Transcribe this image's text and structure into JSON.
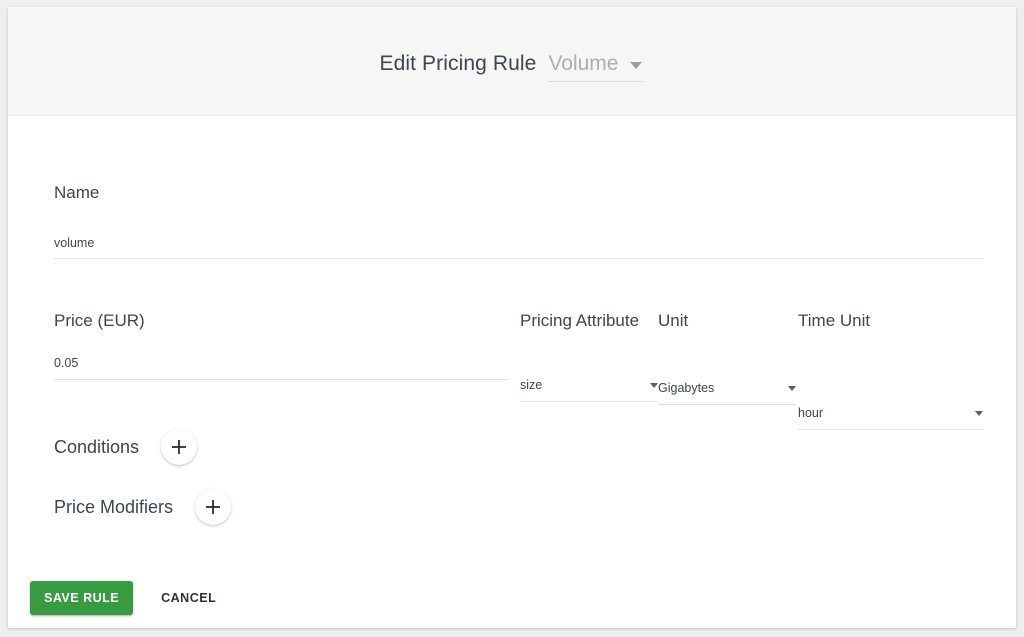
{
  "header": {
    "title": "Edit Pricing Rule",
    "rule_select": {
      "value": "Volume",
      "icon": "caret-down-icon"
    }
  },
  "form": {
    "name": {
      "label": "Name",
      "value": "volume"
    },
    "price": {
      "label": "Price (EUR)",
      "value": "0.05"
    },
    "pricing_attribute": {
      "label": "Pricing Attribute",
      "value": "size",
      "icon": "caret-down-icon"
    },
    "unit": {
      "label": "Unit",
      "value": "Gigabytes",
      "icon": "caret-down-icon"
    },
    "time_unit": {
      "label": "Time Unit",
      "value": "hour",
      "icon": "caret-down-icon"
    }
  },
  "sections": {
    "conditions": {
      "label": "Conditions",
      "add_icon": "plus-icon"
    },
    "price_modifiers": {
      "label": "Price Modifiers",
      "add_icon": "plus-icon"
    }
  },
  "actions": {
    "save_label": "SAVE RULE",
    "cancel_label": "CANCEL"
  },
  "colors": {
    "accent_green": "#389b41",
    "text_primary": "#3c4650",
    "muted": "#aeaeae",
    "card_header_bg": "#f6f6f6",
    "page_bg": "#eeeeee"
  }
}
